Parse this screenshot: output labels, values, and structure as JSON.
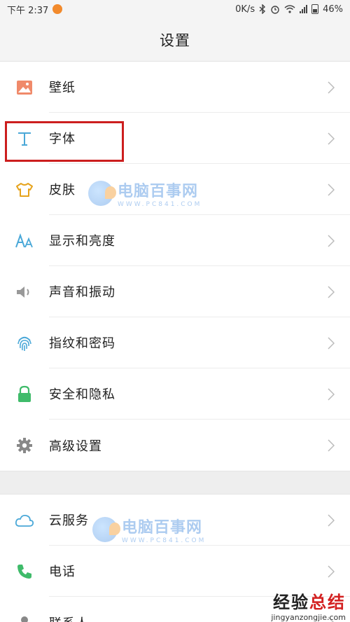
{
  "status_bar": {
    "time": "下午 2:37",
    "net_speed": "0K/s",
    "battery": "46%"
  },
  "header": {
    "title": "设置"
  },
  "group1": [
    {
      "label": "壁纸",
      "icon": "wallpaper-icon"
    },
    {
      "label": "字体",
      "icon": "font-icon"
    },
    {
      "label": "皮肤",
      "icon": "skin-icon"
    },
    {
      "label": "显示和亮度",
      "icon": "display-icon"
    },
    {
      "label": "声音和振动",
      "icon": "sound-icon"
    },
    {
      "label": "指纹和密码",
      "icon": "fingerprint-icon"
    },
    {
      "label": "安全和隐私",
      "icon": "lock-icon"
    },
    {
      "label": "高级设置",
      "icon": "gear-icon"
    }
  ],
  "group2": [
    {
      "label": "云服务",
      "icon": "cloud-icon"
    },
    {
      "label": "电话",
      "icon": "phone-icon"
    },
    {
      "label": "联系人",
      "icon": "contacts-icon"
    }
  ],
  "watermark": {
    "main": "电脑百事网",
    "sub": "WWW.PC841.COM"
  },
  "corner_mark": {
    "main_a": "经验",
    "main_b": "总结",
    "sub": "jingyanzongjie.com"
  },
  "colors": {
    "highlight": "#cc1e1e",
    "accent_blue": "#4aa8d8"
  }
}
